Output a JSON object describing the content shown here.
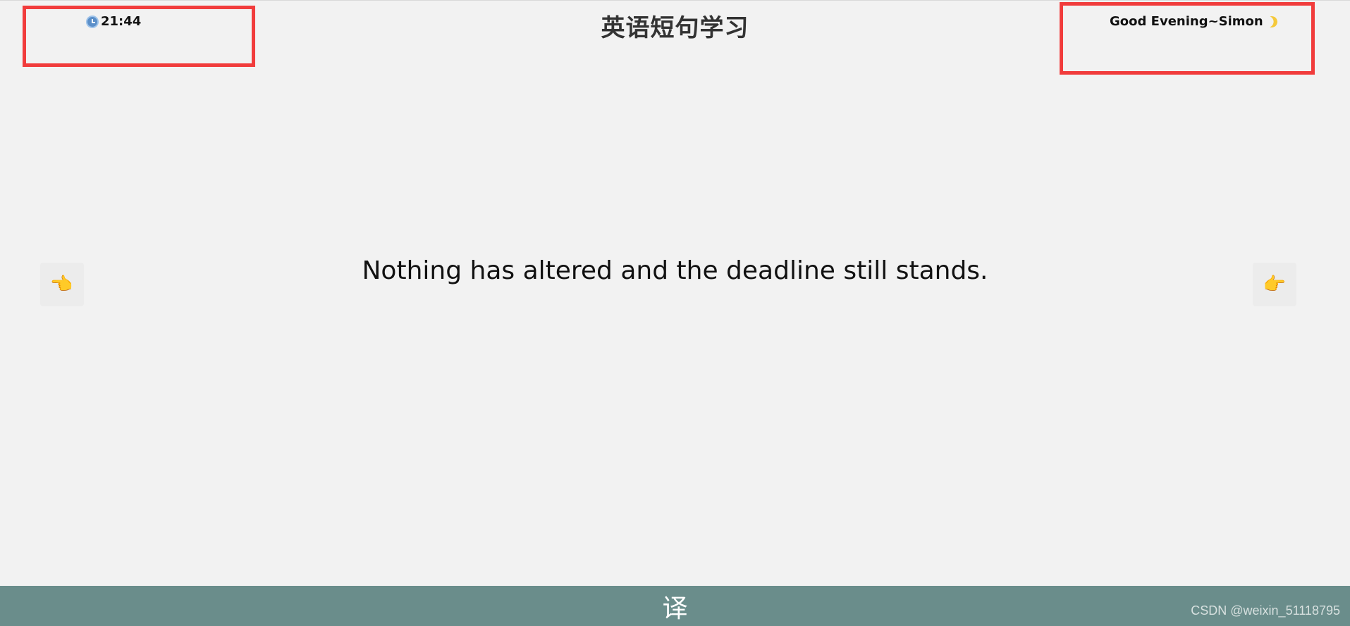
{
  "header": {
    "time": "21:44",
    "title": "英语短句学习",
    "greeting": "Good Evening~Simon",
    "clock_icon": "clock-icon",
    "moon_icon": "crescent-moon-icon"
  },
  "main": {
    "sentence": "Nothing has altered and the deadline still stands.",
    "prev_icon": "pointing-hand-icon",
    "next_icon": "pointing-hand-icon"
  },
  "footer": {
    "translate_label": "译",
    "watermark": "CSDN @weixin_51118795",
    "bar_color": "#6a8d8b"
  },
  "annotations": {
    "color": "#f13c3c"
  }
}
